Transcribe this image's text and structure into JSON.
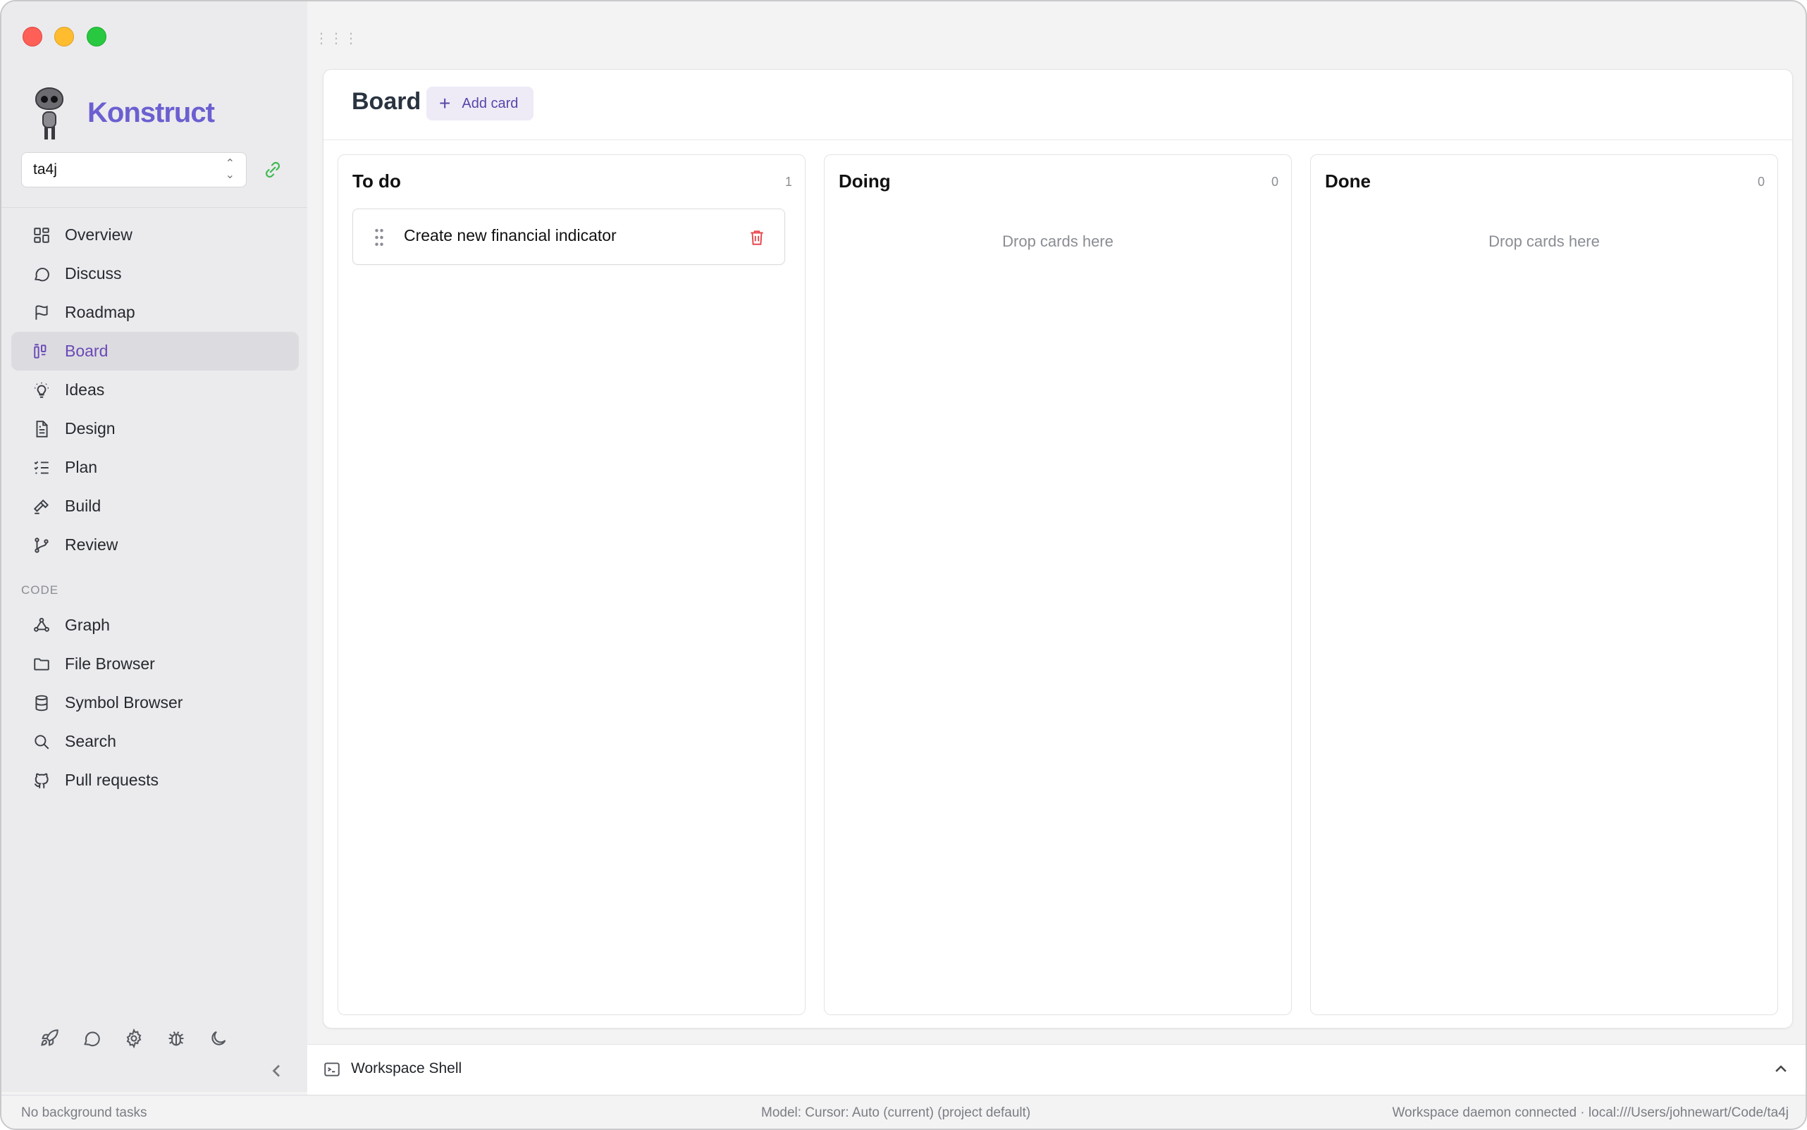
{
  "app": {
    "name": "Konstruct"
  },
  "project": {
    "selected": "ta4j"
  },
  "nav": {
    "items": [
      {
        "id": "overview",
        "label": "Overview",
        "icon": "grid-icon"
      },
      {
        "id": "discuss",
        "label": "Discuss",
        "icon": "chat-bubble-icon"
      },
      {
        "id": "roadmap",
        "label": "Roadmap",
        "icon": "flag-icon"
      },
      {
        "id": "board",
        "label": "Board",
        "icon": "kanban-icon",
        "active": true
      },
      {
        "id": "ideas",
        "label": "Ideas",
        "icon": "lightbulb-icon"
      },
      {
        "id": "design",
        "label": "Design",
        "icon": "document-icon"
      },
      {
        "id": "plan",
        "label": "Plan",
        "icon": "checklist-icon"
      },
      {
        "id": "build",
        "label": "Build",
        "icon": "hammer-icon"
      },
      {
        "id": "review",
        "label": "Review",
        "icon": "git-branch-icon"
      }
    ],
    "code_section_label": "CODE",
    "code_items": [
      {
        "id": "graph",
        "label": "Graph",
        "icon": "graph-nodes-icon"
      },
      {
        "id": "file-browser",
        "label": "File Browser",
        "icon": "folder-icon"
      },
      {
        "id": "symbol-browser",
        "label": "Symbol Browser",
        "icon": "database-icon"
      },
      {
        "id": "search",
        "label": "Search",
        "icon": "search-icon"
      },
      {
        "id": "pull-requests",
        "label": "Pull requests",
        "icon": "github-icon"
      }
    ]
  },
  "footer_icons": [
    "rocket-icon",
    "chat-bubble-icon",
    "gear-icon",
    "bug-icon",
    "moon-icon"
  ],
  "board": {
    "title": "Board",
    "add_card_label": "Add card",
    "columns": [
      {
        "title": "To do",
        "count": "1",
        "cards": [
          {
            "title": "Create new financial indicator"
          }
        ]
      },
      {
        "title": "Doing",
        "count": "0",
        "empty_hint": "Drop cards here"
      },
      {
        "title": "Done",
        "count": "0",
        "empty_hint": "Drop cards here"
      }
    ]
  },
  "shell": {
    "label": "Workspace Shell"
  },
  "status": {
    "left": "No background tasks",
    "middle": "Model: Cursor: Auto (current) (project default)",
    "right": "Workspace daemon connected · local:///Users/johnewart/Code/ta4j"
  },
  "colors": {
    "accent": "#6b5fd1",
    "active_nav_text": "#6b48b7",
    "delete": "#e5484d",
    "link_ok": "#3fb950"
  }
}
